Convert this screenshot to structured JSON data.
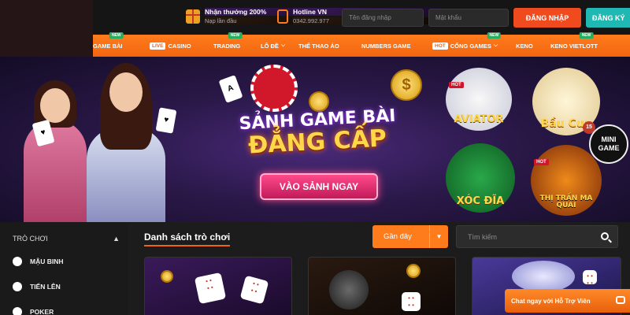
{
  "header": {
    "promo_title": "Nhận thưởng 200%",
    "promo_sub": "Nạp lần đầu",
    "hotline_title": "Hotline VN",
    "hotline_number": "0342.992.977",
    "username_placeholder": "Tên đăng nhập",
    "password_placeholder": "Mật khẩu",
    "login_label": "ĐĂNG NHẬP",
    "register_label": "ĐĂNG KÝ"
  },
  "nav": {
    "new_tag": "NEW",
    "live_tag": "LIVE",
    "hot_tag": "HOT",
    "items": [
      {
        "label": "GAME BÀI"
      },
      {
        "label": "CASINO"
      },
      {
        "label": "TRADING"
      },
      {
        "label": "LÔ ĐỀ"
      },
      {
        "label": "THỂ THAO ẢO"
      },
      {
        "label": "NUMBERS GAME"
      },
      {
        "label": "CỔNG GAMES"
      },
      {
        "label": "KENO"
      },
      {
        "label": "KENO VIETLOTT"
      }
    ]
  },
  "hero": {
    "title_line1": "SẢNH GAME BÀI",
    "title_line2": "ĐẲNG CẤP",
    "cta_label": "VÀO SẢNH NGAY",
    "games": [
      {
        "label": "AVIATOR",
        "hot": "HOT"
      },
      {
        "label": "Bầu Cua",
        "hot": ""
      },
      {
        "label": "XÓC ĐĨA",
        "hot": ""
      },
      {
        "label": "THỊ TRẤN MA QUÁI",
        "hot": "HOT"
      }
    ],
    "mini_game": "MINI GAME",
    "mini_num": "15"
  },
  "sidebar": {
    "heading": "TRÒ CHƠI",
    "items": [
      {
        "label": "MẬU BINH"
      },
      {
        "label": "TIẾN LÊN"
      },
      {
        "label": "POKER"
      }
    ]
  },
  "content": {
    "list_title": "Danh sách trò chơi",
    "sort_label": "Gần đây",
    "search_placeholder": "Tìm kiếm"
  },
  "chat": {
    "label": "Chat ngay với Hỗ Trợ Viên"
  },
  "colors": {
    "accent_orange": "#f26510",
    "login_red": "#f04a1f",
    "register_teal": "#1fb8b2",
    "dark_bg": "#1c1c1c"
  }
}
